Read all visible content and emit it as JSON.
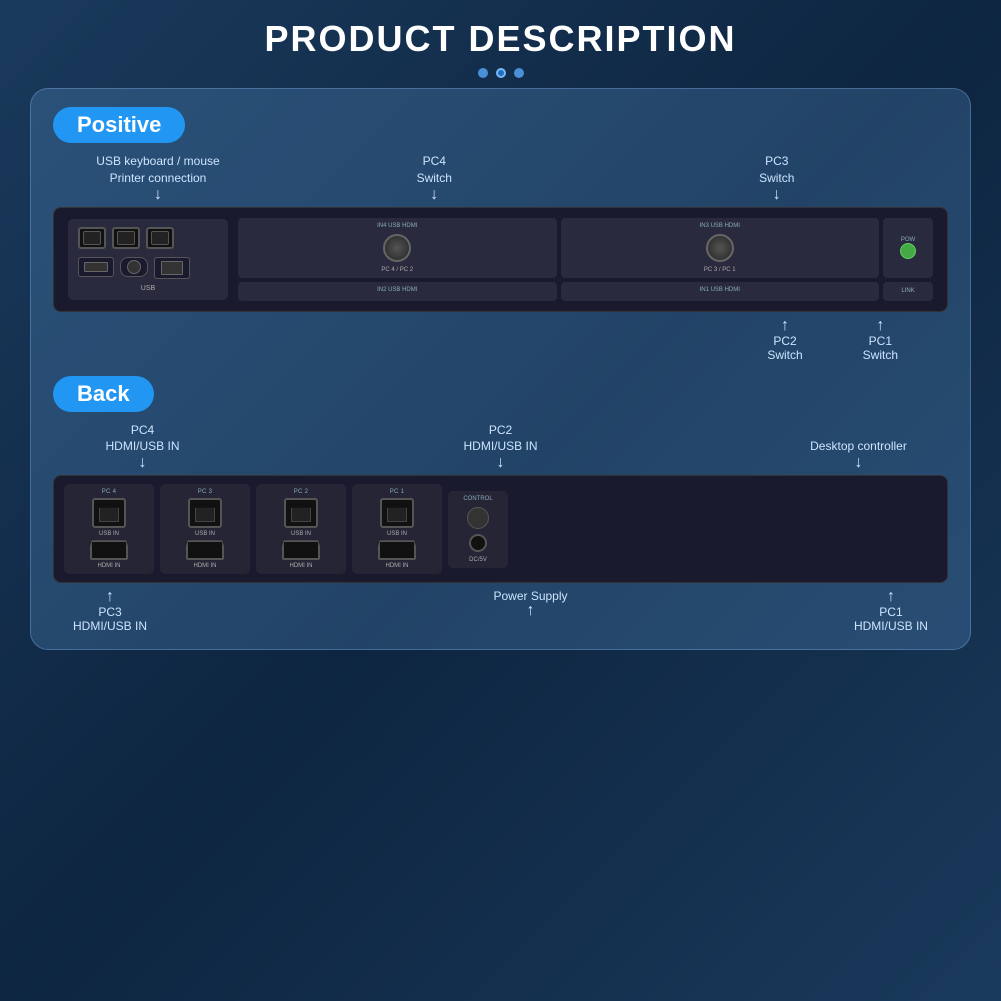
{
  "page": {
    "title": "PRODUCT DESCRIPTION",
    "dots": [
      {
        "active": false
      },
      {
        "active": true
      },
      {
        "active": false
      }
    ]
  },
  "positive": {
    "badge": "Positive",
    "label_usb": "USB keyboard / mouse\nPrinter connection",
    "label_pc4": "PC4\nSwitch",
    "label_pc3": "PC3\nSwitch",
    "label_pc2": "PC2\nSwitch",
    "label_pc1": "PC1\nSwitch",
    "front_device": {
      "usb_label": "USB",
      "cells": [
        {
          "top": "IN4",
          "sub": "USB HDMI"
        },
        {
          "top": "IN3",
          "sub": "USB HDMI"
        },
        {
          "top": "POW"
        },
        {
          "top": "PC 4",
          "sub": "PC 2"
        },
        {
          "top": "PC 3",
          "sub": "PC 1"
        },
        {
          "top": ""
        },
        {
          "top": "IN2",
          "sub": "USB HDMI"
        },
        {
          "top": "IN1",
          "sub": "USB HDMI"
        },
        {
          "top": "LINK"
        }
      ]
    }
  },
  "back": {
    "badge": "Back",
    "label_pc4": "PC4\nHDMI/USB IN",
    "label_pc2": "PC2\nHDMI/USB IN",
    "label_desktop": "Desktop controller",
    "label_pc3": "PC3\nHDMI/USB IN",
    "label_pc1": "PC1\nHDMI/USB IN",
    "label_power": "Power Supply",
    "ports": [
      {
        "pc": "PC 4",
        "usb": "USB IN",
        "hdmi": "HDMI IN"
      },
      {
        "pc": "PC 3",
        "usb": "USB IN",
        "hdmi": "HDMI IN"
      },
      {
        "pc": "PC 2",
        "usb": "USB IN",
        "hdmi": "HDMI IN"
      },
      {
        "pc": "PC 1",
        "usb": "USB IN",
        "hdmi": "HDMI IN"
      }
    ],
    "control": "CONTROL",
    "dc": "DC/5V"
  }
}
